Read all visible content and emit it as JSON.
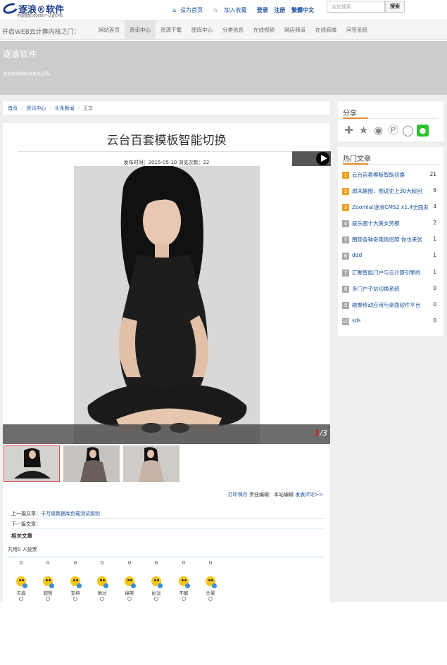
{
  "header": {
    "logo_name": "逐浪®软件",
    "logo_sub": "中国首款100000个认证CMS",
    "links": [
      "设为首页",
      "加入收藏",
      "登录",
      "注册",
      "繁體中文"
    ],
    "search_placeholder": "全站搜索",
    "search_button": "搜索"
  },
  "nav": {
    "brand": "开启WEB云计算内核之门：",
    "items": [
      "网站首页",
      "资讯中心",
      "资源下载",
      "图库中心",
      "分类信息",
      "在线视频",
      "网店频道",
      "在线商城",
      "问答系统"
    ],
    "active": "资讯中心"
  },
  "banner": {
    "title": "逐浪软件",
    "subtitle": "手机和电脑的表现无边界。"
  },
  "breadcrumb": [
    "首页",
    "资讯中心",
    "头条新闻",
    "正文"
  ],
  "article": {
    "title": "云台百套模板智能切换",
    "meta": "发布时间：2015-05-10 浏览次数：22",
    "counter_current": "1",
    "counter_total": "/3",
    "actions_print": "打印保存",
    "actions_editor": "责任编辑：本站编辑",
    "actions_comment": "发表评论>>",
    "prev_label": "上一篇文章：",
    "prev_link": "千万级数据库负载测试级别",
    "next_label": "下一篇文章：",
    "related": "相关文章",
    "vote_total": "共用0 人投票"
  },
  "moods": [
    {
      "label": "欠扁",
      "count": "0"
    },
    {
      "label": "超赞",
      "count": "0"
    },
    {
      "label": "支持",
      "count": "0"
    },
    {
      "label": "难过",
      "count": "0"
    },
    {
      "label": "搞笑",
      "count": "0"
    },
    {
      "label": "扯淡",
      "count": "0"
    },
    {
      "label": "不解",
      "count": "0"
    },
    {
      "label": "头晕",
      "count": "0"
    }
  ],
  "sidebar": {
    "share_title": "分享",
    "share_icons": [
      "plus-icon",
      "star-icon",
      "weibo-icon",
      "pinterest-icon",
      "renren-icon",
      "wechat-icon"
    ],
    "hot_title": "热门文章",
    "hot": [
      {
        "rank": "1",
        "title": "云台百套模板智能切换",
        "count": "21"
      },
      {
        "rank": "2",
        "title": "周末趣图：图说史上30大超回",
        "count": "8"
      },
      {
        "rank": "3",
        "title": "Zoomla!逐浪CMS2 x1.4全面发",
        "count": "4"
      },
      {
        "rank": "4",
        "title": "娱乐圈十大美女劳模",
        "count": "2"
      },
      {
        "rank": "5",
        "title": "围观各种奇葩情侣照 你也来张",
        "count": "1"
      },
      {
        "rank": "6",
        "title": "ddd",
        "count": "1"
      },
      {
        "rank": "7",
        "title": "汇聚智能门户与云计算引擎的",
        "count": "1"
      },
      {
        "rank": "8",
        "title": "多门户子站切换系统",
        "count": "0"
      },
      {
        "rank": "9",
        "title": "融聚移动应用与桌面软件平台",
        "count": "0"
      },
      {
        "rank": "10",
        "title": "sds",
        "count": "0"
      }
    ]
  },
  "colors": {
    "brand_blue": "#1b3a8c",
    "link": "#1b4f9c",
    "accent_orange": "#e48b2e",
    "banner": "#cccccc"
  }
}
